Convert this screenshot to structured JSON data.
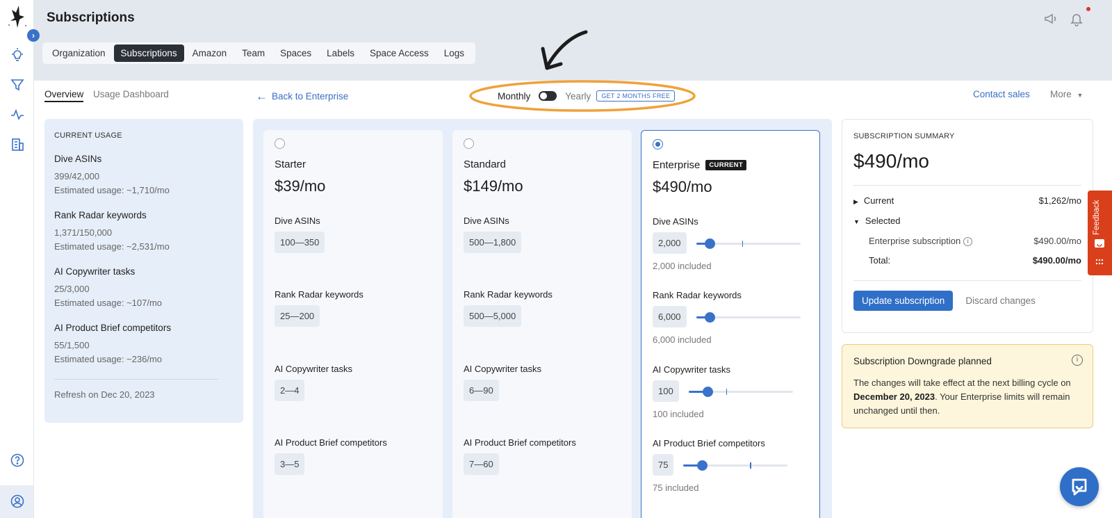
{
  "header": {
    "title": "Subscriptions",
    "tabs": [
      "Organization",
      "Subscriptions",
      "Amazon",
      "Team",
      "Spaces",
      "Labels",
      "Space Access",
      "Logs"
    ],
    "active_tab": "Subscriptions"
  },
  "subnav": {
    "overview": "Overview",
    "usage_dashboard": "Usage Dashboard"
  },
  "back_link": "Back to Enterprise",
  "billing": {
    "monthly": "Monthly",
    "yearly": "Yearly",
    "promo": "GET 2 MONTHS FREE"
  },
  "contact_sales": "Contact sales",
  "more": "More",
  "usage": {
    "title": "CURRENT USAGE",
    "items": [
      {
        "name": "Dive ASINs",
        "value": "399/42,000",
        "estimate": "Estimated usage: ~1,710/mo"
      },
      {
        "name": "Rank Radar keywords",
        "value": "1,371/150,000",
        "estimate": "Estimated usage: ~2,531/mo"
      },
      {
        "name": "AI Copywriter tasks",
        "value": "25/3,000",
        "estimate": "Estimated usage: ~107/mo"
      },
      {
        "name": "AI Product Brief competitors",
        "value": "55/1,500",
        "estimate": "Estimated usage: ~236/mo"
      }
    ],
    "refresh": "Refresh on Dec 20, 2023"
  },
  "plans": [
    {
      "name": "Starter",
      "price": "$39/mo",
      "features": [
        {
          "name": "Dive ASINs",
          "range": "100—350"
        },
        {
          "name": "Rank Radar keywords",
          "range": "25—200"
        },
        {
          "name": "AI Copywriter tasks",
          "range": "2—4"
        },
        {
          "name": "AI Product Brief competitors",
          "range": "3—5"
        }
      ]
    },
    {
      "name": "Standard",
      "price": "$149/mo",
      "features": [
        {
          "name": "Dive ASINs",
          "range": "500—1,800"
        },
        {
          "name": "Rank Radar keywords",
          "range": "500—5,000"
        },
        {
          "name": "AI Copywriter tasks",
          "range": "6—90"
        },
        {
          "name": "AI Product Brief competitors",
          "range": "7—60"
        }
      ]
    },
    {
      "name": "Enterprise",
      "badge": "CURRENT",
      "price": "$490/mo",
      "features": [
        {
          "name": "Dive ASINs",
          "value": "2,000",
          "included": "2,000 included",
          "slider": 0.13,
          "tick": 0.44
        },
        {
          "name": "Rank Radar keywords",
          "value": "6,000",
          "included": "6,000 included",
          "slider": 0.13,
          "tick": null
        },
        {
          "name": "AI Copywriter tasks",
          "value": "100",
          "included": "100 included",
          "slider": 0.18,
          "tick": 0.36
        },
        {
          "name": "AI Product Brief competitors",
          "value": "75",
          "included": "75 included",
          "slider": 0.18,
          "tick": 0.64
        }
      ]
    }
  ],
  "summary": {
    "title": "SUBSCRIPTION SUMMARY",
    "price": "$490/mo",
    "current_label": "Current",
    "current_value": "$1,262/mo",
    "selected_label": "Selected",
    "line_label": "Enterprise subscription",
    "line_value": "$490.00/mo",
    "total_label": "Total:",
    "total_value": "$490.00/mo",
    "update_button": "Update subscription",
    "discard_button": "Discard changes"
  },
  "alert": {
    "title": "Subscription Downgrade planned",
    "text_before": "The changes will take effect at the next billing cycle on ",
    "date": "December 20, 2023",
    "text_after": ". Your Enterprise limits will remain unchanged until then."
  },
  "feedback": "Feedback",
  "colors": {
    "accent": "#3a72c9",
    "highlight": "#f0a13a",
    "feedback": "#d93f1b"
  }
}
